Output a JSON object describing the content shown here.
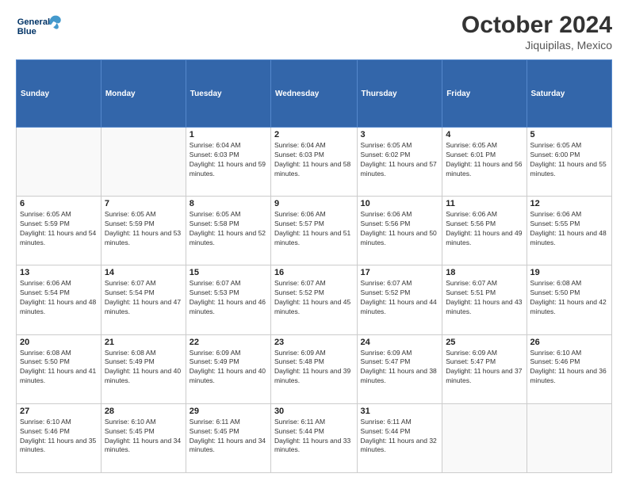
{
  "header": {
    "logo_line1": "General",
    "logo_line2": "Blue",
    "month": "October 2024",
    "location": "Jiquipilas, Mexico"
  },
  "weekdays": [
    "Sunday",
    "Monday",
    "Tuesday",
    "Wednesday",
    "Thursday",
    "Friday",
    "Saturday"
  ],
  "weeks": [
    [
      {
        "day": "",
        "info": ""
      },
      {
        "day": "",
        "info": ""
      },
      {
        "day": "1",
        "info": "Sunrise: 6:04 AM\nSunset: 6:03 PM\nDaylight: 11 hours and 59 minutes."
      },
      {
        "day": "2",
        "info": "Sunrise: 6:04 AM\nSunset: 6:03 PM\nDaylight: 11 hours and 58 minutes."
      },
      {
        "day": "3",
        "info": "Sunrise: 6:05 AM\nSunset: 6:02 PM\nDaylight: 11 hours and 57 minutes."
      },
      {
        "day": "4",
        "info": "Sunrise: 6:05 AM\nSunset: 6:01 PM\nDaylight: 11 hours and 56 minutes."
      },
      {
        "day": "5",
        "info": "Sunrise: 6:05 AM\nSunset: 6:00 PM\nDaylight: 11 hours and 55 minutes."
      }
    ],
    [
      {
        "day": "6",
        "info": "Sunrise: 6:05 AM\nSunset: 5:59 PM\nDaylight: 11 hours and 54 minutes."
      },
      {
        "day": "7",
        "info": "Sunrise: 6:05 AM\nSunset: 5:59 PM\nDaylight: 11 hours and 53 minutes."
      },
      {
        "day": "8",
        "info": "Sunrise: 6:05 AM\nSunset: 5:58 PM\nDaylight: 11 hours and 52 minutes."
      },
      {
        "day": "9",
        "info": "Sunrise: 6:06 AM\nSunset: 5:57 PM\nDaylight: 11 hours and 51 minutes."
      },
      {
        "day": "10",
        "info": "Sunrise: 6:06 AM\nSunset: 5:56 PM\nDaylight: 11 hours and 50 minutes."
      },
      {
        "day": "11",
        "info": "Sunrise: 6:06 AM\nSunset: 5:56 PM\nDaylight: 11 hours and 49 minutes."
      },
      {
        "day": "12",
        "info": "Sunrise: 6:06 AM\nSunset: 5:55 PM\nDaylight: 11 hours and 48 minutes."
      }
    ],
    [
      {
        "day": "13",
        "info": "Sunrise: 6:06 AM\nSunset: 5:54 PM\nDaylight: 11 hours and 48 minutes."
      },
      {
        "day": "14",
        "info": "Sunrise: 6:07 AM\nSunset: 5:54 PM\nDaylight: 11 hours and 47 minutes."
      },
      {
        "day": "15",
        "info": "Sunrise: 6:07 AM\nSunset: 5:53 PM\nDaylight: 11 hours and 46 minutes."
      },
      {
        "day": "16",
        "info": "Sunrise: 6:07 AM\nSunset: 5:52 PM\nDaylight: 11 hours and 45 minutes."
      },
      {
        "day": "17",
        "info": "Sunrise: 6:07 AM\nSunset: 5:52 PM\nDaylight: 11 hours and 44 minutes."
      },
      {
        "day": "18",
        "info": "Sunrise: 6:07 AM\nSunset: 5:51 PM\nDaylight: 11 hours and 43 minutes."
      },
      {
        "day": "19",
        "info": "Sunrise: 6:08 AM\nSunset: 5:50 PM\nDaylight: 11 hours and 42 minutes."
      }
    ],
    [
      {
        "day": "20",
        "info": "Sunrise: 6:08 AM\nSunset: 5:50 PM\nDaylight: 11 hours and 41 minutes."
      },
      {
        "day": "21",
        "info": "Sunrise: 6:08 AM\nSunset: 5:49 PM\nDaylight: 11 hours and 40 minutes."
      },
      {
        "day": "22",
        "info": "Sunrise: 6:09 AM\nSunset: 5:49 PM\nDaylight: 11 hours and 40 minutes."
      },
      {
        "day": "23",
        "info": "Sunrise: 6:09 AM\nSunset: 5:48 PM\nDaylight: 11 hours and 39 minutes."
      },
      {
        "day": "24",
        "info": "Sunrise: 6:09 AM\nSunset: 5:47 PM\nDaylight: 11 hours and 38 minutes."
      },
      {
        "day": "25",
        "info": "Sunrise: 6:09 AM\nSunset: 5:47 PM\nDaylight: 11 hours and 37 minutes."
      },
      {
        "day": "26",
        "info": "Sunrise: 6:10 AM\nSunset: 5:46 PM\nDaylight: 11 hours and 36 minutes."
      }
    ],
    [
      {
        "day": "27",
        "info": "Sunrise: 6:10 AM\nSunset: 5:46 PM\nDaylight: 11 hours and 35 minutes."
      },
      {
        "day": "28",
        "info": "Sunrise: 6:10 AM\nSunset: 5:45 PM\nDaylight: 11 hours and 34 minutes."
      },
      {
        "day": "29",
        "info": "Sunrise: 6:11 AM\nSunset: 5:45 PM\nDaylight: 11 hours and 34 minutes."
      },
      {
        "day": "30",
        "info": "Sunrise: 6:11 AM\nSunset: 5:44 PM\nDaylight: 11 hours and 33 minutes."
      },
      {
        "day": "31",
        "info": "Sunrise: 6:11 AM\nSunset: 5:44 PM\nDaylight: 11 hours and 32 minutes."
      },
      {
        "day": "",
        "info": ""
      },
      {
        "day": "",
        "info": ""
      }
    ]
  ]
}
